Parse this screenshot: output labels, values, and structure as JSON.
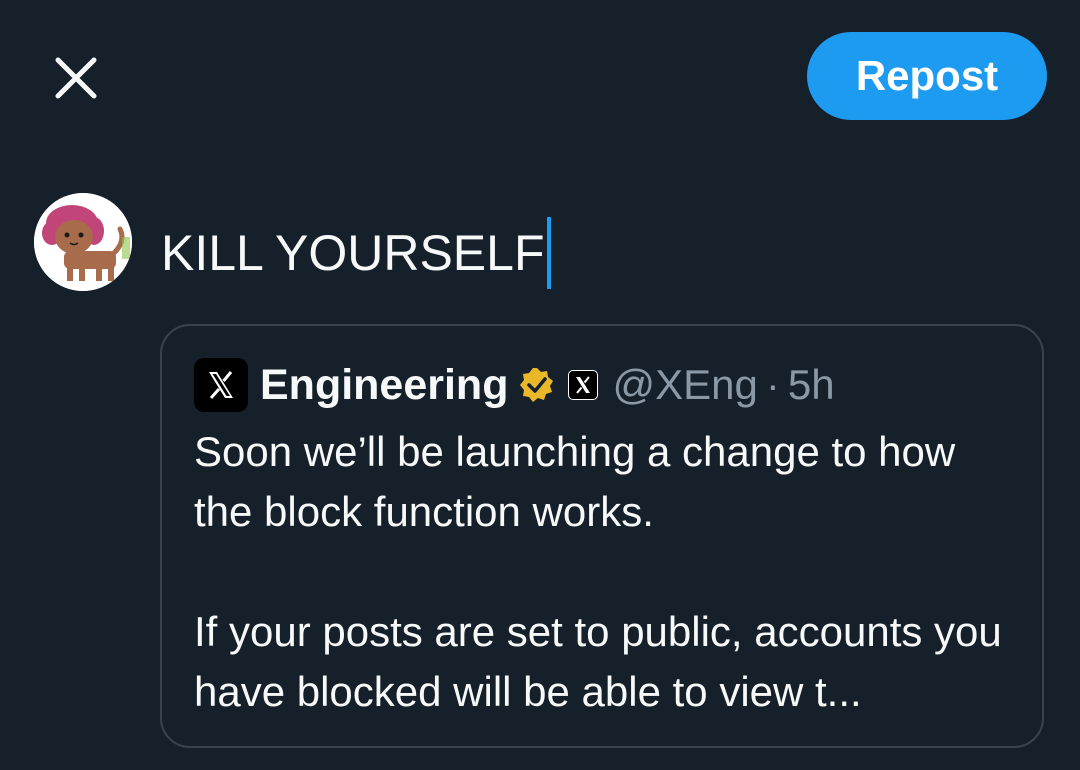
{
  "header": {
    "close_icon": "close-icon",
    "repost_label": "Repost",
    "accent_color": "#1d9bf0"
  },
  "composer": {
    "avatar_icon": "cat-avatar",
    "text": "KILL YOURSELF"
  },
  "quote": {
    "logo_icon": "x-logo-icon",
    "display_name": "Engineering",
    "verified_icon": "gold-verified-badge-icon",
    "affiliate_icon": "x-affiliate-badge-icon",
    "handle": "@XEng",
    "separator": "·",
    "time": "5h",
    "body_line1": "Soon we’ll be launching a change to how the block function works.",
    "body_line2": "If your posts are set to public, accounts you have blocked will be able to view t..."
  },
  "colors": {
    "background": "#15202b",
    "border": "#38444d",
    "secondary_text": "#8b98a5",
    "verified_gold": "#e8b829"
  }
}
